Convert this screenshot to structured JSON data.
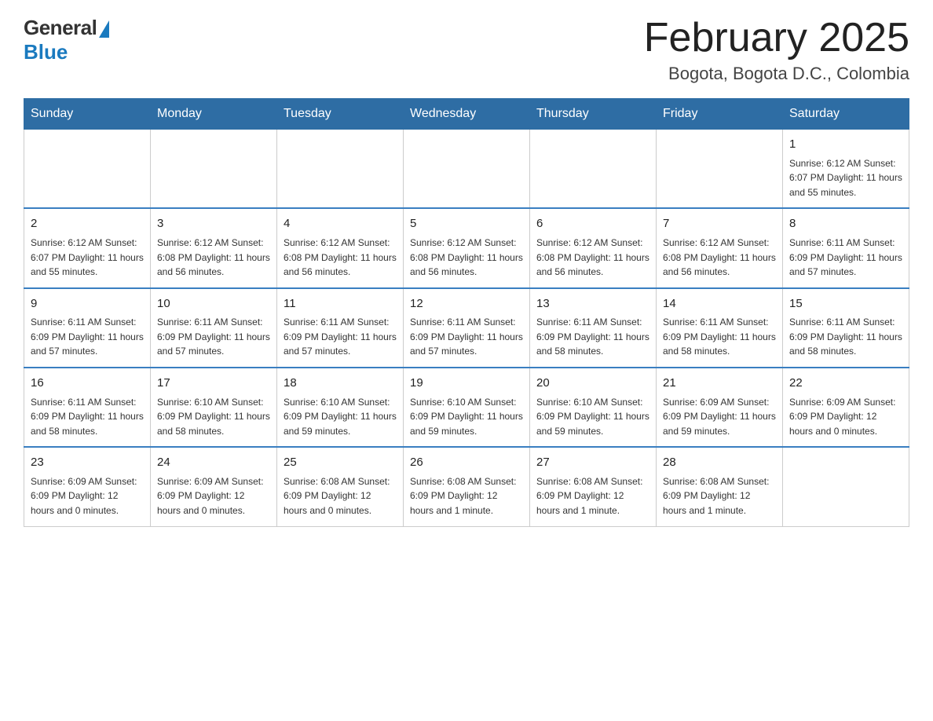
{
  "header": {
    "logo_general": "General",
    "logo_blue": "Blue",
    "title": "February 2025",
    "location": "Bogota, Bogota D.C., Colombia"
  },
  "days_of_week": [
    "Sunday",
    "Monday",
    "Tuesday",
    "Wednesday",
    "Thursday",
    "Friday",
    "Saturday"
  ],
  "weeks": [
    [
      {
        "day": "",
        "info": ""
      },
      {
        "day": "",
        "info": ""
      },
      {
        "day": "",
        "info": ""
      },
      {
        "day": "",
        "info": ""
      },
      {
        "day": "",
        "info": ""
      },
      {
        "day": "",
        "info": ""
      },
      {
        "day": "1",
        "info": "Sunrise: 6:12 AM\nSunset: 6:07 PM\nDaylight: 11 hours and 55 minutes."
      }
    ],
    [
      {
        "day": "2",
        "info": "Sunrise: 6:12 AM\nSunset: 6:07 PM\nDaylight: 11 hours and 55 minutes."
      },
      {
        "day": "3",
        "info": "Sunrise: 6:12 AM\nSunset: 6:08 PM\nDaylight: 11 hours and 56 minutes."
      },
      {
        "day": "4",
        "info": "Sunrise: 6:12 AM\nSunset: 6:08 PM\nDaylight: 11 hours and 56 minutes."
      },
      {
        "day": "5",
        "info": "Sunrise: 6:12 AM\nSunset: 6:08 PM\nDaylight: 11 hours and 56 minutes."
      },
      {
        "day": "6",
        "info": "Sunrise: 6:12 AM\nSunset: 6:08 PM\nDaylight: 11 hours and 56 minutes."
      },
      {
        "day": "7",
        "info": "Sunrise: 6:12 AM\nSunset: 6:08 PM\nDaylight: 11 hours and 56 minutes."
      },
      {
        "day": "8",
        "info": "Sunrise: 6:11 AM\nSunset: 6:09 PM\nDaylight: 11 hours and 57 minutes."
      }
    ],
    [
      {
        "day": "9",
        "info": "Sunrise: 6:11 AM\nSunset: 6:09 PM\nDaylight: 11 hours and 57 minutes."
      },
      {
        "day": "10",
        "info": "Sunrise: 6:11 AM\nSunset: 6:09 PM\nDaylight: 11 hours and 57 minutes."
      },
      {
        "day": "11",
        "info": "Sunrise: 6:11 AM\nSunset: 6:09 PM\nDaylight: 11 hours and 57 minutes."
      },
      {
        "day": "12",
        "info": "Sunrise: 6:11 AM\nSunset: 6:09 PM\nDaylight: 11 hours and 57 minutes."
      },
      {
        "day": "13",
        "info": "Sunrise: 6:11 AM\nSunset: 6:09 PM\nDaylight: 11 hours and 58 minutes."
      },
      {
        "day": "14",
        "info": "Sunrise: 6:11 AM\nSunset: 6:09 PM\nDaylight: 11 hours and 58 minutes."
      },
      {
        "day": "15",
        "info": "Sunrise: 6:11 AM\nSunset: 6:09 PM\nDaylight: 11 hours and 58 minutes."
      }
    ],
    [
      {
        "day": "16",
        "info": "Sunrise: 6:11 AM\nSunset: 6:09 PM\nDaylight: 11 hours and 58 minutes."
      },
      {
        "day": "17",
        "info": "Sunrise: 6:10 AM\nSunset: 6:09 PM\nDaylight: 11 hours and 58 minutes."
      },
      {
        "day": "18",
        "info": "Sunrise: 6:10 AM\nSunset: 6:09 PM\nDaylight: 11 hours and 59 minutes."
      },
      {
        "day": "19",
        "info": "Sunrise: 6:10 AM\nSunset: 6:09 PM\nDaylight: 11 hours and 59 minutes."
      },
      {
        "day": "20",
        "info": "Sunrise: 6:10 AM\nSunset: 6:09 PM\nDaylight: 11 hours and 59 minutes."
      },
      {
        "day": "21",
        "info": "Sunrise: 6:09 AM\nSunset: 6:09 PM\nDaylight: 11 hours and 59 minutes."
      },
      {
        "day": "22",
        "info": "Sunrise: 6:09 AM\nSunset: 6:09 PM\nDaylight: 12 hours and 0 minutes."
      }
    ],
    [
      {
        "day": "23",
        "info": "Sunrise: 6:09 AM\nSunset: 6:09 PM\nDaylight: 12 hours and 0 minutes."
      },
      {
        "day": "24",
        "info": "Sunrise: 6:09 AM\nSunset: 6:09 PM\nDaylight: 12 hours and 0 minutes."
      },
      {
        "day": "25",
        "info": "Sunrise: 6:08 AM\nSunset: 6:09 PM\nDaylight: 12 hours and 0 minutes."
      },
      {
        "day": "26",
        "info": "Sunrise: 6:08 AM\nSunset: 6:09 PM\nDaylight: 12 hours and 1 minute."
      },
      {
        "day": "27",
        "info": "Sunrise: 6:08 AM\nSunset: 6:09 PM\nDaylight: 12 hours and 1 minute."
      },
      {
        "day": "28",
        "info": "Sunrise: 6:08 AM\nSunset: 6:09 PM\nDaylight: 12 hours and 1 minute."
      },
      {
        "day": "",
        "info": ""
      }
    ]
  ]
}
